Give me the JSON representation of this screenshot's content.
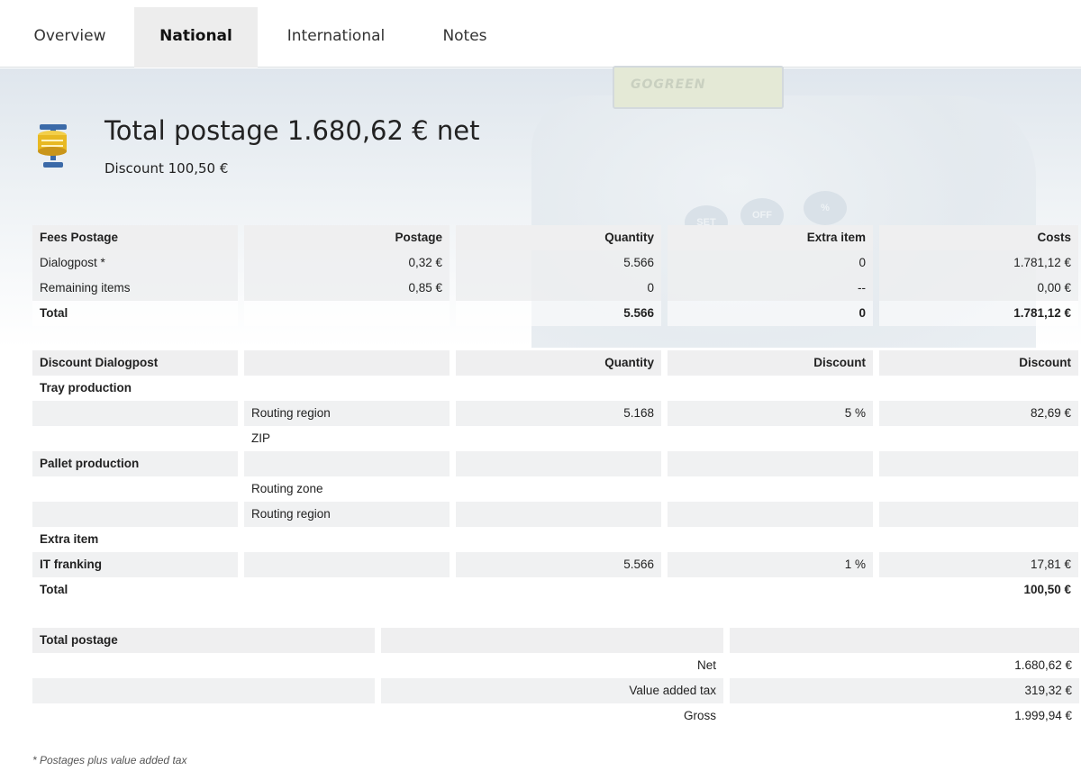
{
  "tabs": [
    {
      "label": "Overview"
    },
    {
      "label": "National"
    },
    {
      "label": "International"
    },
    {
      "label": "Notes"
    }
  ],
  "header": {
    "title": "Total postage 1.680,62 € net",
    "subtitle": "Discount 100,50 €",
    "device_screen_text": "GOGREEN",
    "device_buttons": [
      "SET",
      "OFF",
      "%"
    ]
  },
  "fees": {
    "headers": [
      "Fees Postage",
      "Postage",
      "Quantity",
      "Extra item",
      "Costs"
    ],
    "rows": [
      [
        "Dialogpost *",
        "0,32 €",
        "5.566",
        "0",
        "1.781,12 €"
      ],
      [
        "Remaining items",
        "0,85 €",
        "0",
        "--",
        "0,00 €"
      ]
    ],
    "total": [
      "Total",
      "",
      "5.566",
      "0",
      "1.781,12 €"
    ]
  },
  "discount": {
    "headers": [
      "Discount Dialogpost",
      "",
      "Quantity",
      "Discount",
      "Discount"
    ],
    "rows": [
      [
        "Tray production",
        "",
        "",
        "",
        ""
      ],
      [
        "",
        "Routing region",
        "5.168",
        "5 %",
        "82,69 €"
      ],
      [
        "",
        "ZIP",
        "",
        "",
        ""
      ],
      [
        "Pallet production",
        "",
        "",
        "",
        ""
      ],
      [
        "",
        "Routing zone",
        "",
        "",
        ""
      ],
      [
        "",
        "Routing region",
        "",
        "",
        ""
      ],
      [
        "Extra item",
        "",
        "",
        "",
        ""
      ],
      [
        "IT franking",
        "",
        "5.566",
        "1 %",
        "17,81 €"
      ]
    ],
    "total": [
      "Total",
      "",
      "",
      "",
      "100,50 €"
    ]
  },
  "total_postage": {
    "header": "Total postage",
    "rows": [
      [
        "",
        "Net",
        "1.680,62 €"
      ],
      [
        "",
        "Value added tax",
        "319,32 €"
      ],
      [
        "",
        "Gross",
        "1.999,94 €"
      ]
    ]
  },
  "footnote": "* Postages plus value added tax",
  "colors": {
    "tab_active_bg": "#ededed",
    "header_cell_bg": "#efeff0",
    "icon_gold": "#e8b923",
    "icon_blue": "#3b6aa8"
  }
}
